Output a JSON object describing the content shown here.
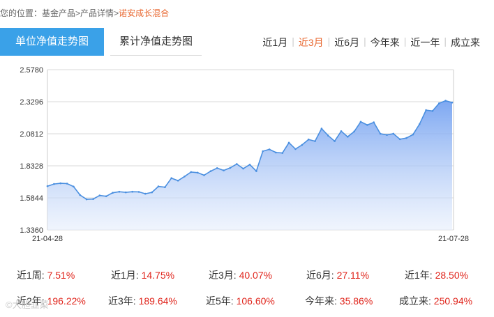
{
  "breadcrumb": {
    "prefix": "您的位置：",
    "items": [
      "基金产品",
      "产品详情"
    ],
    "separator": ">",
    "current": "诺安成长混合"
  },
  "tabs": {
    "active": "单位净值走势图",
    "inactive": "累计净值走势图"
  },
  "ranges": [
    {
      "label": "近1月",
      "selected": false
    },
    {
      "label": "近3月",
      "selected": true
    },
    {
      "label": "近6月",
      "selected": false
    },
    {
      "label": "今年来",
      "selected": false
    },
    {
      "label": "近一年",
      "selected": false
    },
    {
      "label": "成立来",
      "selected": false
    }
  ],
  "colors": {
    "accent": "#3aa1e8",
    "selected": "#e8662e",
    "positive": "#e0251c",
    "line": "#4a8fe0"
  },
  "chart_data": {
    "type": "area",
    "title": "",
    "xlabel": "",
    "ylabel": "",
    "y_ticks": [
      "2.5780",
      "2.3296",
      "2.0812",
      "1.8328",
      "1.5844",
      "1.3360"
    ],
    "x_ticks": [
      "21-04-28",
      "21-07-28"
    ],
    "ylim": [
      1.336,
      2.578
    ],
    "grid": true,
    "series": [
      {
        "values": [
          1.675,
          1.692,
          1.697,
          1.695,
          1.672,
          1.606,
          1.573,
          1.575,
          1.603,
          1.597,
          1.624,
          1.632,
          1.627,
          1.632,
          1.631,
          1.616,
          1.627,
          1.673,
          1.667,
          1.737,
          1.718,
          1.75,
          1.785,
          1.78,
          1.76,
          1.791,
          1.815,
          1.797,
          1.817,
          1.847,
          1.811,
          1.842,
          1.792,
          1.946,
          1.96,
          1.936,
          1.932,
          2.012,
          1.963,
          1.995,
          2.037,
          2.024,
          2.121,
          2.067,
          2.024,
          2.101,
          2.058,
          2.099,
          2.174,
          2.149,
          2.17,
          2.082,
          2.072,
          2.082,
          2.039,
          2.048,
          2.075,
          2.155,
          2.264,
          2.258,
          2.317,
          2.337,
          2.323
        ]
      }
    ]
  },
  "stats": [
    {
      "label": "近1周:",
      "value": "7.51%"
    },
    {
      "label": "近1月:",
      "value": "14.75%"
    },
    {
      "label": "近3月:",
      "value": "40.07%"
    },
    {
      "label": "近6月:",
      "value": "27.11%"
    },
    {
      "label": "近1年:",
      "value": "28.50%"
    },
    {
      "label": "近2年:",
      "value": "196.22%"
    },
    {
      "label": "近3年:",
      "value": "189.64%"
    },
    {
      "label": "近5年:",
      "value": "106.60%"
    },
    {
      "label": "今年来:",
      "value": "35.86%"
    },
    {
      "label": "成立来:",
      "value": "250.94%"
    }
  ],
  "watermark": "©大胆韭菜"
}
